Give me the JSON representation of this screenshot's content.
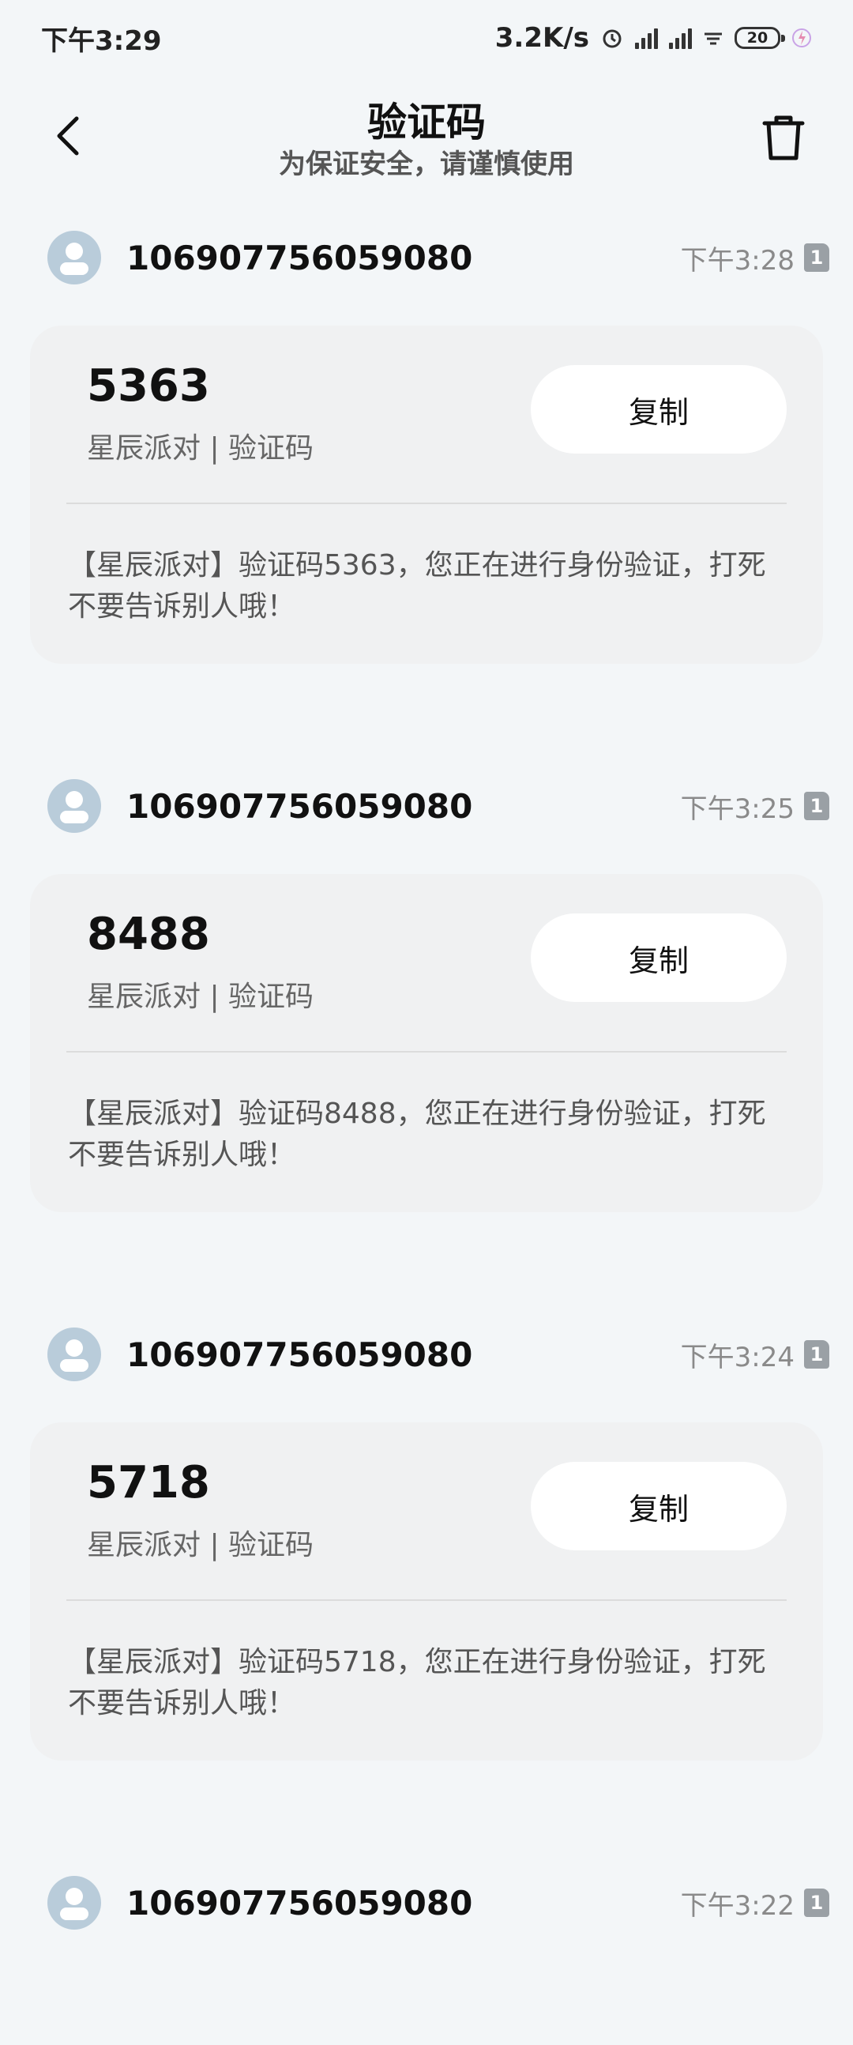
{
  "status_bar": {
    "time": "下午3:29",
    "net_speed": "3.2K/s",
    "battery": "20"
  },
  "header": {
    "title": "验证码",
    "subtitle": "为保证安全，请谨慎使用"
  },
  "messages": [
    {
      "sender": "106907756059080",
      "time": "下午3:28",
      "sim": "1",
      "code": "5363",
      "label": "星辰派对 | 验证码",
      "copy_label": "复制",
      "content": "【星辰派对】验证码5363，您正在进行身份验证，打死不要告诉别人哦！"
    },
    {
      "sender": "106907756059080",
      "time": "下午3:25",
      "sim": "1",
      "code": "8488",
      "label": "星辰派对 | 验证码",
      "copy_label": "复制",
      "content": "【星辰派对】验证码8488，您正在进行身份验证，打死不要告诉别人哦！"
    },
    {
      "sender": "106907756059080",
      "time": "下午3:24",
      "sim": "1",
      "code": "5718",
      "label": "星辰派对 | 验证码",
      "copy_label": "复制",
      "content": "【星辰派对】验证码5718，您正在进行身份验证，打死不要告诉别人哦！"
    },
    {
      "sender": "106907756059080",
      "time": "下午3:22",
      "sim": "1"
    }
  ]
}
